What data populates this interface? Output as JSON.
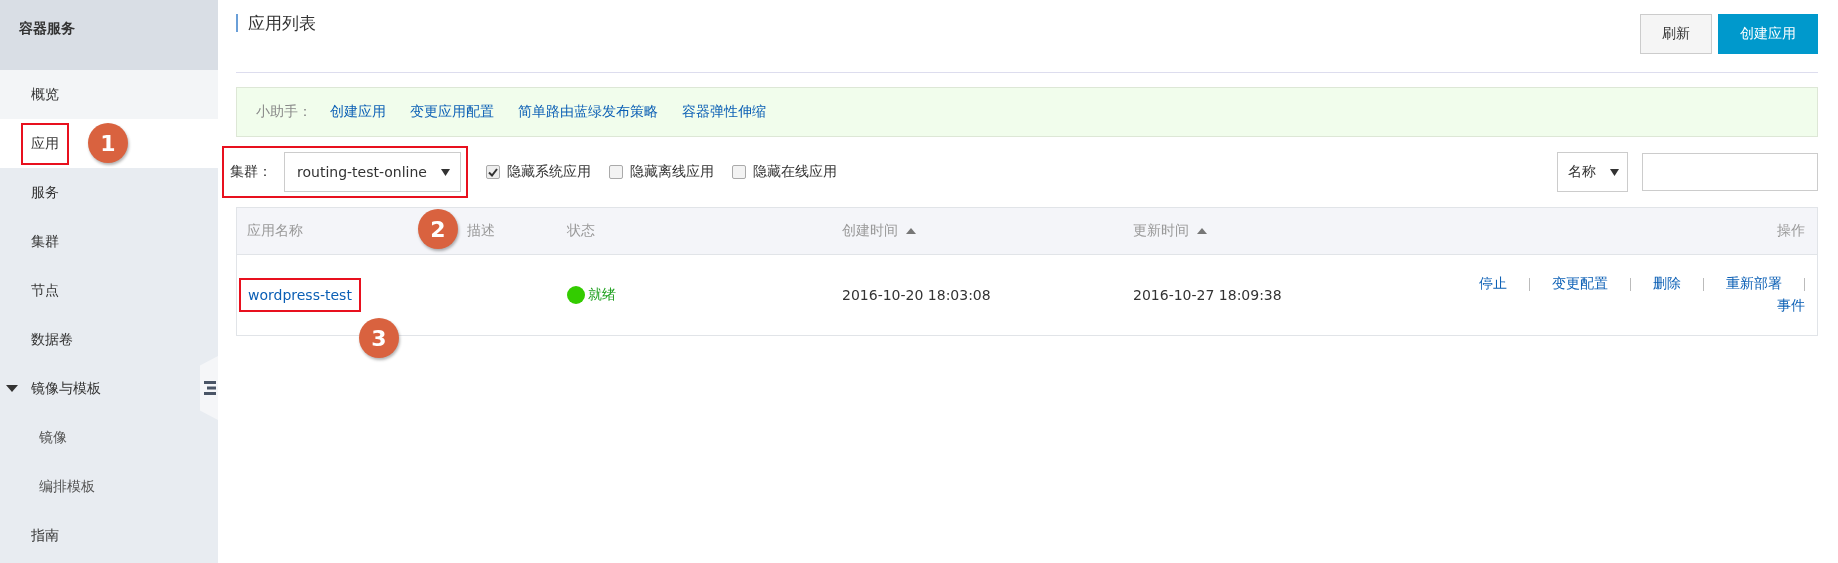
{
  "sidebar": {
    "title": "容器服务",
    "items": [
      {
        "label": "概览",
        "selected": false,
        "highlighted": false
      },
      {
        "label": "应用",
        "selected": true,
        "highlighted": true,
        "callout": "1"
      },
      {
        "label": "服务",
        "selected": false,
        "highlighted": false
      },
      {
        "label": "集群",
        "selected": false,
        "highlighted": false
      },
      {
        "label": "节点",
        "selected": false,
        "highlighted": false
      },
      {
        "label": "数据卷",
        "selected": false,
        "highlighted": false
      },
      {
        "label": "镜像与模板",
        "selected": false,
        "highlighted": false,
        "expanded": true,
        "children": [
          {
            "label": "镜像",
            "selected": false
          },
          {
            "label": "编排模板",
            "selected": false
          }
        ]
      },
      {
        "label": "指南",
        "selected": false,
        "highlighted": false
      }
    ]
  },
  "page": {
    "title": "应用列表",
    "buttons": [
      {
        "label": "刷新",
        "kind": "default"
      },
      {
        "label": "创建应用",
        "kind": "primary"
      }
    ]
  },
  "helper": {
    "label": "小助手：",
    "links": [
      "创建应用",
      "变更应用配置",
      "简单路由蓝绿发布策略",
      "容器弹性伸缩"
    ]
  },
  "filters": {
    "cluster_label": "集群：",
    "cluster_value": "routing-test-online",
    "highlighted": true,
    "callout": "2",
    "checkboxes": [
      {
        "label": "隐藏系统应用",
        "checked": true
      },
      {
        "label": "隐藏离线应用",
        "checked": false
      },
      {
        "label": "隐藏在线应用",
        "checked": false
      }
    ],
    "search_by": "名称"
  },
  "table": {
    "columns": [
      {
        "label": "应用名称"
      },
      {
        "label": "描述"
      },
      {
        "label": "状态"
      },
      {
        "label": "创建时间",
        "sortable": true
      },
      {
        "label": "更新时间",
        "sortable": true
      },
      {
        "label": "操作"
      }
    ],
    "rows": [
      {
        "name": "wordpress-test",
        "highlighted": true,
        "callout": "3",
        "status": "就绪",
        "color": "#33cc00",
        "created": "2016-10-20 18:03:08",
        "updated": "2016-10-27 18:09:38",
        "actions": [
          "停止",
          "变更配置",
          "删除",
          "重新部署",
          "事件"
        ]
      }
    ]
  }
}
